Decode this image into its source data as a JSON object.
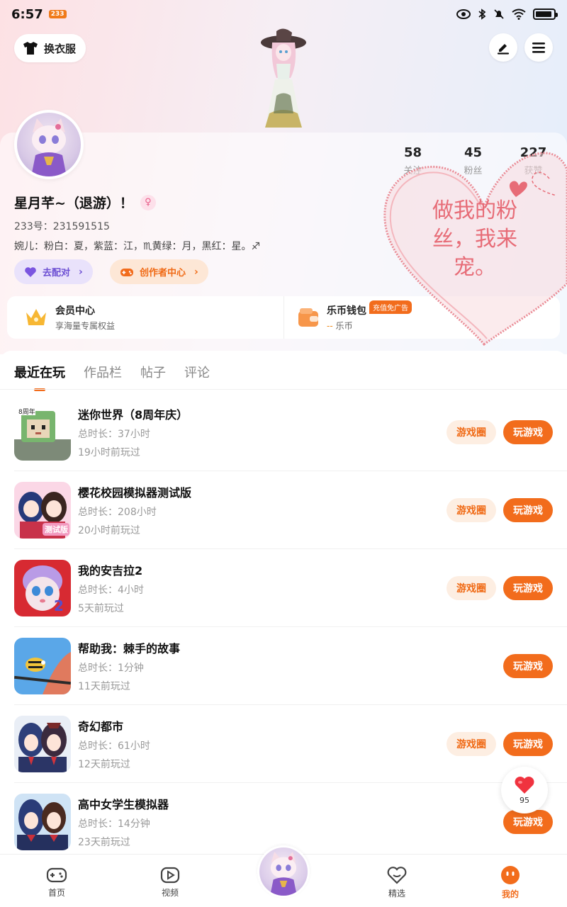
{
  "status_bar": {
    "time": "6:57",
    "app_badge": "233"
  },
  "header": {
    "outfit_label": "换衣服"
  },
  "profile": {
    "username": "星月芊~（退游）！",
    "id_text": "233号：231591515",
    "bio": "婉儿：粉白：夏，紫蓝：江，♏黄绿：月，黑红：星。♐",
    "stats": [
      {
        "num": "58",
        "label": "关注"
      },
      {
        "num": "45",
        "label": "粉丝"
      },
      {
        "num": "227",
        "label": "获赞"
      }
    ],
    "match_label": "去配对",
    "creator_label": "创作者中心"
  },
  "member": {
    "vip_title": "会员中心",
    "vip_sub": "享海量专属权益",
    "wallet_title": "乐币钱包",
    "wallet_badge": "充值免广告",
    "wallet_value": "--",
    "wallet_unit": "乐币"
  },
  "overlay": {
    "heart_text": "做我的粉丝，我来宠。"
  },
  "tabs": [
    {
      "label": "最近在玩"
    },
    {
      "label": "作品栏"
    },
    {
      "label": "帖子"
    },
    {
      "label": "评论"
    }
  ],
  "games": [
    {
      "title": "迷你世界（8周年庆）",
      "duration": "总时长：37小时",
      "last_played": "19小时前玩过",
      "circle_label": "游戏圈",
      "play_label": "玩游戏"
    },
    {
      "title": "樱花校园模拟器测试版",
      "duration": "总时长：208小时",
      "last_played": "20小时前玩过",
      "circle_label": "游戏圈",
      "play_label": "玩游戏",
      "icon_text": "测试版"
    },
    {
      "title": "我的安吉拉2",
      "duration": "总时长：4小时",
      "last_played": "5天前玩过",
      "circle_label": "游戏圈",
      "play_label": "玩游戏",
      "icon_text": "2"
    },
    {
      "title": "帮助我：棘手的故事",
      "duration": "总时长：1分钟",
      "last_played": "11天前玩过",
      "play_label": "玩游戏"
    },
    {
      "title": "奇幻都市",
      "duration": "总时长：61小时",
      "last_played": "12天前玩过",
      "circle_label": "游戏圈",
      "play_label": "玩游戏"
    },
    {
      "title": "高中女学生模拟器",
      "duration": "总时长：14分钟",
      "last_played": "23天前玩过",
      "play_label": "玩游戏"
    }
  ],
  "float_heart": {
    "count": "95"
  },
  "nav": [
    {
      "label": "首页"
    },
    {
      "label": "视频"
    },
    {
      "label": "精选"
    },
    {
      "label": "我的"
    }
  ],
  "colors": {
    "accent": "#f26c1c",
    "heart": "#e76c77"
  }
}
